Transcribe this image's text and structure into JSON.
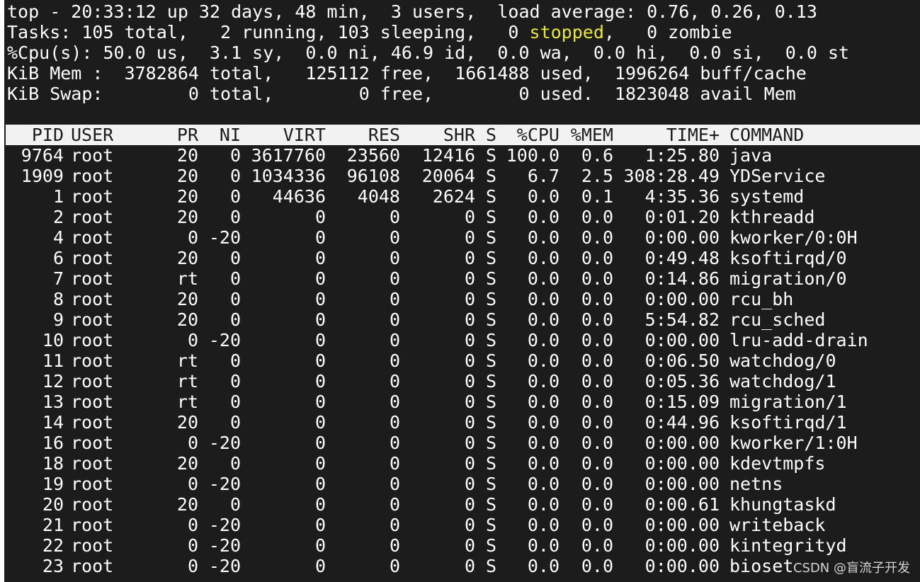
{
  "summary": {
    "line1": "top - 20:33:12 up 32 days, 48 min,  3 users,  load average: 0.76, 0.26, 0.13",
    "line2_pre": "Tasks: 105 total,   2 running, 103 sleeping,   0 ",
    "line2_stopped": "stopped",
    "line2_post": ",   0 zombie",
    "line3": "%Cpu(s): 50.0 us,  3.1 sy,  0.0 ni, 46.9 id,  0.0 wa,  0.0 hi,  0.0 si,  0.0 st",
    "line4": "KiB Mem :  3782864 total,   125112 free,  1661488 used,  1996264 buff/cache",
    "line5": "KiB Swap:        0 total,        0 free,        0 used.  1823048 avail Mem"
  },
  "columns": {
    "pid": "PID",
    "user": "USER",
    "pr": "PR",
    "ni": "NI",
    "virt": "VIRT",
    "res": "RES",
    "shr": "SHR",
    "s": "S",
    "cpu": "%CPU",
    "mem": "%MEM",
    "time": "TIME+",
    "command": "COMMAND"
  },
  "processes": [
    {
      "pid": "9764",
      "user": "root",
      "pr": "20",
      "ni": "0",
      "virt": "3617760",
      "res": "23560",
      "shr": "12416",
      "s": "S",
      "cpu": "100.0",
      "mem": "0.6",
      "time": "1:25.80",
      "command": "java"
    },
    {
      "pid": "1909",
      "user": "root",
      "pr": "20",
      "ni": "0",
      "virt": "1034336",
      "res": "96108",
      "shr": "20064",
      "s": "S",
      "cpu": "6.7",
      "mem": "2.5",
      "time": "308:28.49",
      "command": "YDService"
    },
    {
      "pid": "1",
      "user": "root",
      "pr": "20",
      "ni": "0",
      "virt": "44636",
      "res": "4048",
      "shr": "2624",
      "s": "S",
      "cpu": "0.0",
      "mem": "0.1",
      "time": "4:35.36",
      "command": "systemd"
    },
    {
      "pid": "2",
      "user": "root",
      "pr": "20",
      "ni": "0",
      "virt": "0",
      "res": "0",
      "shr": "0",
      "s": "S",
      "cpu": "0.0",
      "mem": "0.0",
      "time": "0:01.20",
      "command": "kthreadd"
    },
    {
      "pid": "4",
      "user": "root",
      "pr": "0",
      "ni": "-20",
      "virt": "0",
      "res": "0",
      "shr": "0",
      "s": "S",
      "cpu": "0.0",
      "mem": "0.0",
      "time": "0:00.00",
      "command": "kworker/0:0H"
    },
    {
      "pid": "6",
      "user": "root",
      "pr": "20",
      "ni": "0",
      "virt": "0",
      "res": "0",
      "shr": "0",
      "s": "S",
      "cpu": "0.0",
      "mem": "0.0",
      "time": "0:49.48",
      "command": "ksoftirqd/0"
    },
    {
      "pid": "7",
      "user": "root",
      "pr": "rt",
      "ni": "0",
      "virt": "0",
      "res": "0",
      "shr": "0",
      "s": "S",
      "cpu": "0.0",
      "mem": "0.0",
      "time": "0:14.86",
      "command": "migration/0"
    },
    {
      "pid": "8",
      "user": "root",
      "pr": "20",
      "ni": "0",
      "virt": "0",
      "res": "0",
      "shr": "0",
      "s": "S",
      "cpu": "0.0",
      "mem": "0.0",
      "time": "0:00.00",
      "command": "rcu_bh"
    },
    {
      "pid": "9",
      "user": "root",
      "pr": "20",
      "ni": "0",
      "virt": "0",
      "res": "0",
      "shr": "0",
      "s": "S",
      "cpu": "0.0",
      "mem": "0.0",
      "time": "5:54.82",
      "command": "rcu_sched"
    },
    {
      "pid": "10",
      "user": "root",
      "pr": "0",
      "ni": "-20",
      "virt": "0",
      "res": "0",
      "shr": "0",
      "s": "S",
      "cpu": "0.0",
      "mem": "0.0",
      "time": "0:00.00",
      "command": "lru-add-drain"
    },
    {
      "pid": "11",
      "user": "root",
      "pr": "rt",
      "ni": "0",
      "virt": "0",
      "res": "0",
      "shr": "0",
      "s": "S",
      "cpu": "0.0",
      "mem": "0.0",
      "time": "0:06.50",
      "command": "watchdog/0"
    },
    {
      "pid": "12",
      "user": "root",
      "pr": "rt",
      "ni": "0",
      "virt": "0",
      "res": "0",
      "shr": "0",
      "s": "S",
      "cpu": "0.0",
      "mem": "0.0",
      "time": "0:05.36",
      "command": "watchdog/1"
    },
    {
      "pid": "13",
      "user": "root",
      "pr": "rt",
      "ni": "0",
      "virt": "0",
      "res": "0",
      "shr": "0",
      "s": "S",
      "cpu": "0.0",
      "mem": "0.0",
      "time": "0:15.09",
      "command": "migration/1"
    },
    {
      "pid": "14",
      "user": "root",
      "pr": "20",
      "ni": "0",
      "virt": "0",
      "res": "0",
      "shr": "0",
      "s": "S",
      "cpu": "0.0",
      "mem": "0.0",
      "time": "0:44.96",
      "command": "ksoftirqd/1"
    },
    {
      "pid": "16",
      "user": "root",
      "pr": "0",
      "ni": "-20",
      "virt": "0",
      "res": "0",
      "shr": "0",
      "s": "S",
      "cpu": "0.0",
      "mem": "0.0",
      "time": "0:00.00",
      "command": "kworker/1:0H"
    },
    {
      "pid": "18",
      "user": "root",
      "pr": "20",
      "ni": "0",
      "virt": "0",
      "res": "0",
      "shr": "0",
      "s": "S",
      "cpu": "0.0",
      "mem": "0.0",
      "time": "0:00.00",
      "command": "kdevtmpfs"
    },
    {
      "pid": "19",
      "user": "root",
      "pr": "0",
      "ni": "-20",
      "virt": "0",
      "res": "0",
      "shr": "0",
      "s": "S",
      "cpu": "0.0",
      "mem": "0.0",
      "time": "0:00.00",
      "command": "netns"
    },
    {
      "pid": "20",
      "user": "root",
      "pr": "20",
      "ni": "0",
      "virt": "0",
      "res": "0",
      "shr": "0",
      "s": "S",
      "cpu": "0.0",
      "mem": "0.0",
      "time": "0:00.61",
      "command": "khungtaskd"
    },
    {
      "pid": "21",
      "user": "root",
      "pr": "0",
      "ni": "-20",
      "virt": "0",
      "res": "0",
      "shr": "0",
      "s": "S",
      "cpu": "0.0",
      "mem": "0.0",
      "time": "0:00.00",
      "command": "writeback"
    },
    {
      "pid": "22",
      "user": "root",
      "pr": "0",
      "ni": "-20",
      "virt": "0",
      "res": "0",
      "shr": "0",
      "s": "S",
      "cpu": "0.0",
      "mem": "0.0",
      "time": "0:00.00",
      "command": "kintegrityd"
    },
    {
      "pid": "23",
      "user": "root",
      "pr": "0",
      "ni": "-20",
      "virt": "0",
      "res": "0",
      "shr": "0",
      "s": "S",
      "cpu": "0.0",
      "mem": "0.0",
      "time": "0:00.00",
      "command": "bioset"
    }
  ],
  "watermark": "CSDN @盲流子开发",
  "colors": {
    "background": "#1c1c1c",
    "foreground": "#ffffff",
    "stopped_highlight": "#e8e83a",
    "header_bg": "#f2f2f2"
  }
}
